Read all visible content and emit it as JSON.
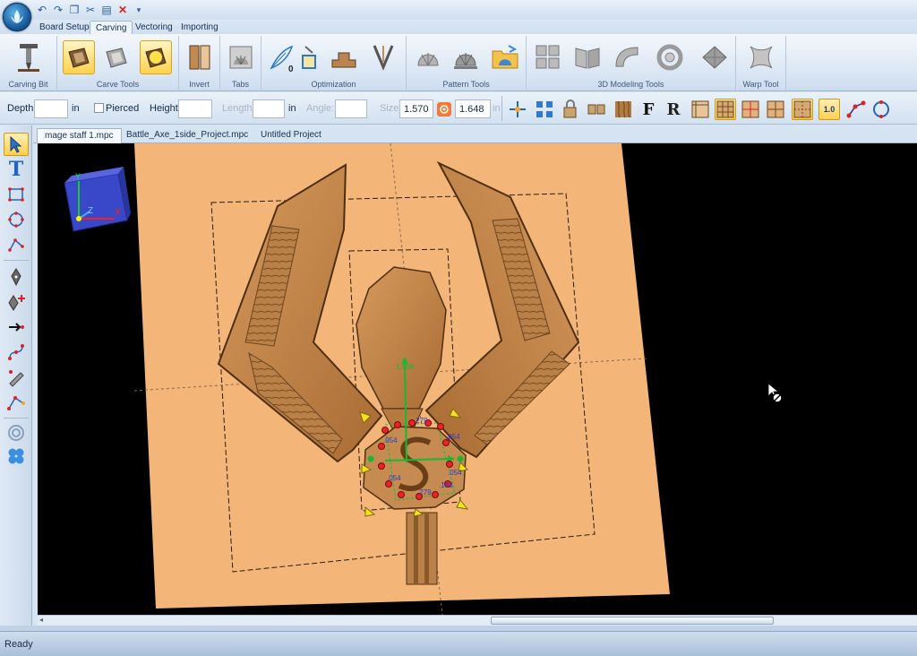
{
  "ribbon_tabs": [
    "Board Setup",
    "Carving",
    "Vectoring",
    "Importing"
  ],
  "ribbon_groups": {
    "carving_bit": "Carving Bit",
    "carve_tools": "Carve Tools",
    "invert": "Invert",
    "tabs": "Tabs",
    "optimization": "Optimization",
    "optimization_badge": "0",
    "pattern_tools": "Pattern Tools",
    "modeling_3d": "3D Modeling Tools",
    "warp_tool": "Warp Tool"
  },
  "properties": {
    "depth_label": "Depth",
    "depth_value": "",
    "depth_unit": "in",
    "pierced_label": "Pierced",
    "height_label": "Height",
    "height_value": "",
    "length_label": "Length",
    "length_value": "",
    "length_unit": "in",
    "angle_label": "Angle:",
    "angle_value": "",
    "size_label": "Size",
    "size_width": "1.570",
    "size_height": "1.648",
    "size_unit": "in",
    "font_bold_letter": "F",
    "font_regular_letter": "R",
    "lo_label": "1.0"
  },
  "document_tabs": [
    "mage staff 1.mpc",
    "Battle_Axe_1side_Project.mpc",
    "Untitled Project"
  ],
  "active_document_tab": 0,
  "axes": {
    "x": "X",
    "y": "Y",
    "z": "Z"
  },
  "dimensions": {
    "green_vertical": "1.568",
    "top_width": ".279",
    "left_upper": ".054",
    "right_upper": ".054",
    "right_lower": ".054",
    "left_lower": ".054",
    "bottom_width": ".279",
    "right_mid": ".183"
  },
  "status": {
    "text": "Ready"
  },
  "colors": {
    "board": "#f4b578",
    "wood_dark": "#8a5a2b",
    "wood_mid": "#c48a4d",
    "selection_highlight": "#ffd24d",
    "ribbon_bg": "#dae6f3"
  },
  "icons": {
    "app_menu": "app-orb-icon",
    "cursor": "no-entry-cursor-icon"
  }
}
